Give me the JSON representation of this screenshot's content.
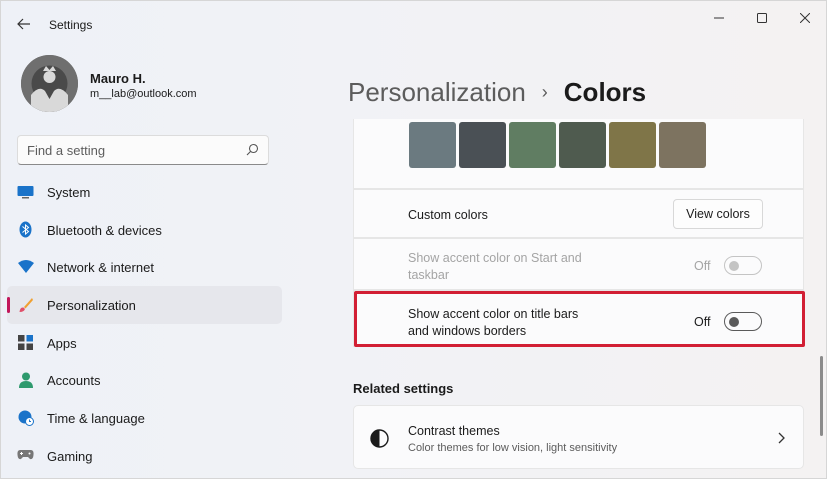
{
  "window": {
    "title": "Settings"
  },
  "user": {
    "name": "Mauro H.",
    "email": "m__lab@outlook.com"
  },
  "search": {
    "placeholder": "Find a setting"
  },
  "sidebar": {
    "items": [
      {
        "label": "System",
        "icon": "monitor-icon"
      },
      {
        "label": "Bluetooth & devices",
        "icon": "bluetooth-icon"
      },
      {
        "label": "Network & internet",
        "icon": "wifi-icon"
      },
      {
        "label": "Personalization",
        "icon": "brush-icon",
        "active": true
      },
      {
        "label": "Apps",
        "icon": "apps-icon"
      },
      {
        "label": "Accounts",
        "icon": "person-icon"
      },
      {
        "label": "Time & language",
        "icon": "globe-clock-icon"
      },
      {
        "label": "Gaming",
        "icon": "gamepad-icon"
      }
    ]
  },
  "breadcrumb": {
    "parent": "Personalization",
    "separator": "›",
    "current": "Colors"
  },
  "accent_swatches": [
    "#6b7a80",
    "#4a5055",
    "#607d62",
    "#4f5b4f",
    "#7f7548",
    "#7d7360"
  ],
  "custom_colors": {
    "label": "Custom colors",
    "button": "View colors"
  },
  "start_taskbar": {
    "label_line1": "Show accent color on Start and",
    "label_line2": "taskbar",
    "state": "Off",
    "disabled": true
  },
  "title_bars": {
    "label_line1": "Show accent color on title bars",
    "label_line2": "and windows borders",
    "state": "Off"
  },
  "related": {
    "heading": "Related settings",
    "contrast": {
      "title": "Contrast themes",
      "subtitle": "Color themes for low vision, light sensitivity"
    }
  },
  "colors": {
    "accent_indicator": "#c2185b",
    "highlight_box": "#d21f34"
  }
}
